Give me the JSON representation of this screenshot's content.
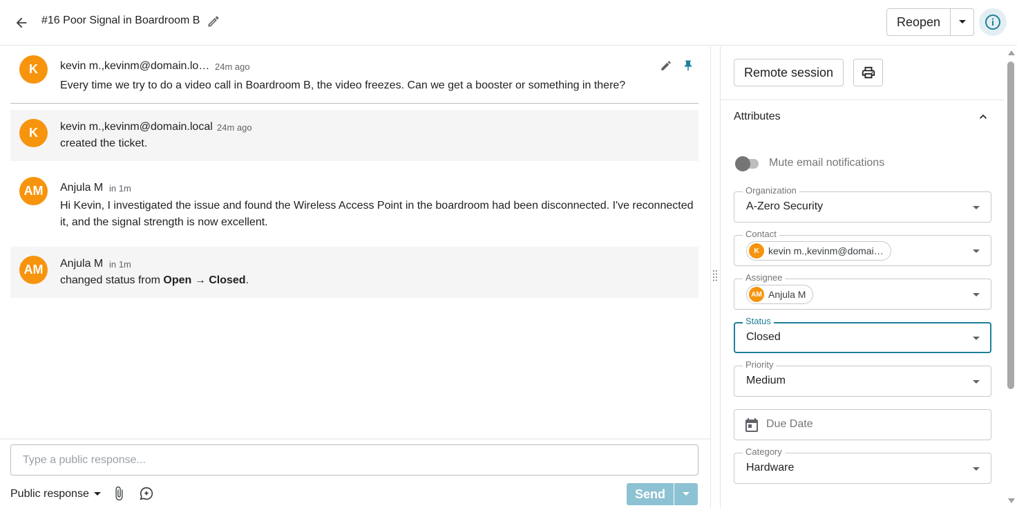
{
  "header": {
    "title": "#16 Poor Signal in Boardroom B",
    "reopen_label": "Reopen"
  },
  "colors": {
    "accent": "#1e7f99",
    "avatar": "#f7940d",
    "send_disabled": "#8cc2d3"
  },
  "thread": [
    {
      "initials": "K",
      "author": "kevin m.,kevinm@domain.lo…",
      "time": "24m ago",
      "text": "Every time we try to do a video call in Boardroom B, the video freezes. Can we get a booster or something in there?"
    },
    {
      "initials": "K",
      "author": "kevin m.,kevinm@domain.local",
      "time": "24m ago",
      "text": "created the ticket."
    },
    {
      "initials": "AM",
      "author": "Anjula M",
      "time": "in 1m",
      "text_line1": "Hi Kevin, I investigated the issue and found the Wireless Access Point in the boardroom had been disconnected. I've reconnected",
      "text_line2": "it, and the signal strength is now excellent."
    },
    {
      "initials": "AM",
      "author": "Anjula M",
      "time": "in 1m",
      "text_prefix": "changed status from ",
      "from": "Open",
      "arrow": "→",
      "to": "Closed",
      "suffix": "."
    }
  ],
  "composer": {
    "placeholder": "Type a public response...",
    "response_type": "Public response",
    "send_label": "Send"
  },
  "panel": {
    "remote_session_label": "Remote session",
    "section_title": "Attributes",
    "mute_label": "Mute email notifications",
    "mute_enabled": false,
    "fields": {
      "organization": {
        "label": "Organization",
        "value": "A-Zero Security"
      },
      "contact": {
        "label": "Contact",
        "value": "kevin m.,kevinm@domai…",
        "initials": "K"
      },
      "assignee": {
        "label": "Assignee",
        "value": "Anjula M",
        "initials": "AM"
      },
      "status": {
        "label": "Status",
        "value": "Closed"
      },
      "priority": {
        "label": "Priority",
        "value": "Medium"
      },
      "due_date": {
        "placeholder": "Due Date"
      },
      "category": {
        "label": "Category",
        "value": "Hardware"
      }
    }
  },
  "icons": {
    "back": "arrow-left-icon",
    "edit": "pencil-icon",
    "pin": "pin-icon",
    "info": "info-icon",
    "print": "printer-icon",
    "attach": "paperclip-icon",
    "ai": "sparkle-chat-icon",
    "calendar": "calendar-icon"
  }
}
